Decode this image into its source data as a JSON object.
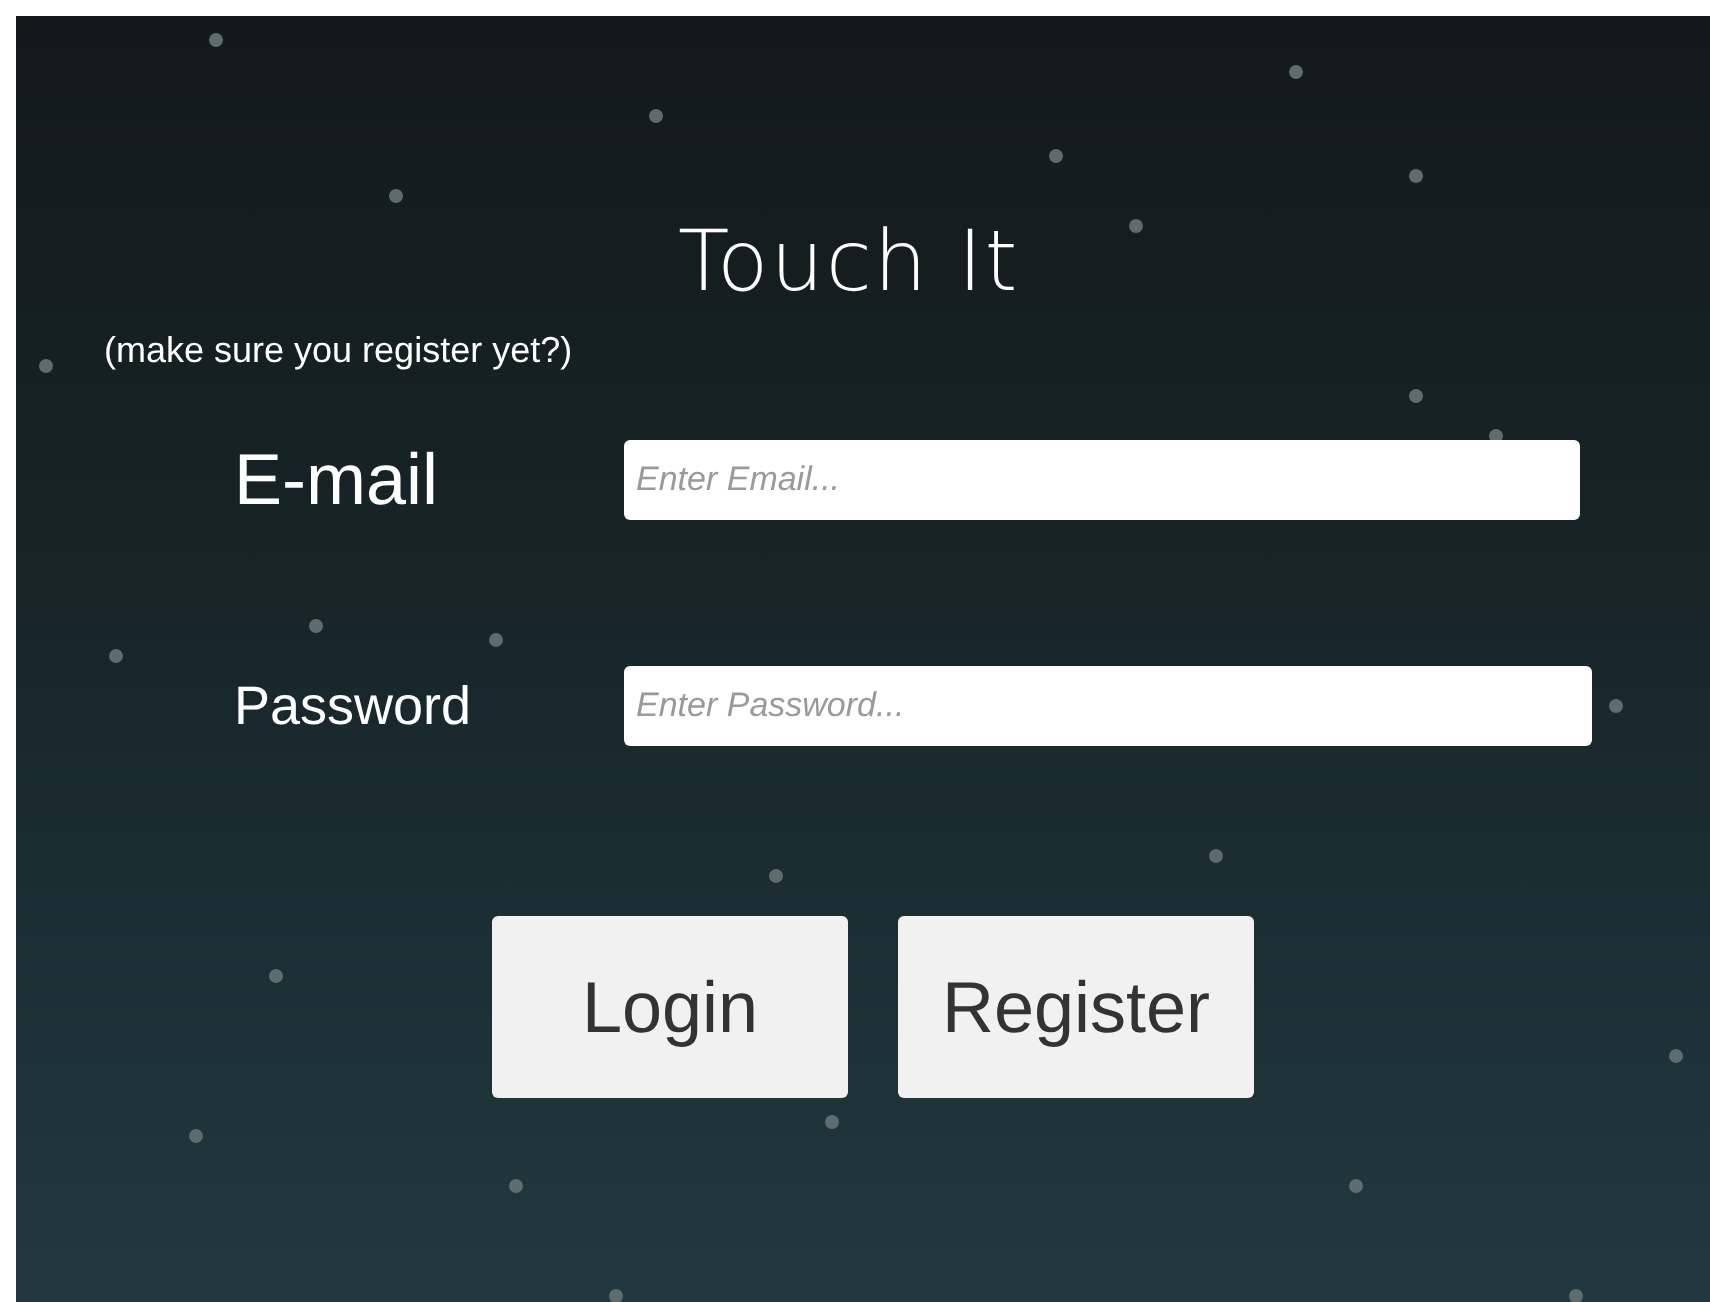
{
  "title": "Touch It",
  "hint": "(make sure you register yet?)",
  "fields": [
    {
      "label": "E-mail",
      "placeholder": "Enter Email...",
      "kind": "email"
    },
    {
      "label": "Password",
      "placeholder": "Enter Password...",
      "kind": "password"
    }
  ],
  "buttons": [
    "Login",
    "Register"
  ]
}
